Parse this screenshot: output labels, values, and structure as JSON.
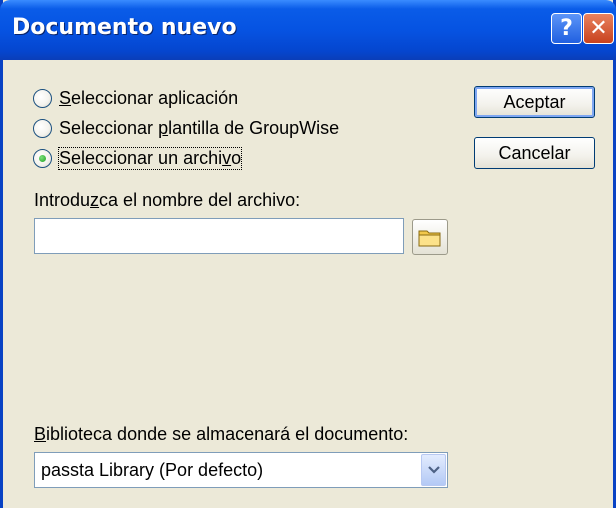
{
  "window": {
    "title": "Documento nuevo",
    "help_label": "?",
    "close_label": "✕"
  },
  "options": [
    {
      "pre": "",
      "accel": "S",
      "post": "eleccionar aplicación",
      "checked": false
    },
    {
      "pre": "Seleccionar ",
      "accel": "p",
      "post": "lantilla de GroupWise",
      "checked": false
    },
    {
      "pre": "Seleccionar un archi",
      "accel": "v",
      "post": "o",
      "checked": true
    }
  ],
  "buttons": {
    "ok_label": "Aceptar",
    "cancel_label": "Cancelar"
  },
  "file": {
    "label_pre": "Introdu",
    "label_accel": "z",
    "label_post": "ca el nombre del archivo:",
    "value": "",
    "browse_icon": "folder-icon"
  },
  "library": {
    "label_pre": "",
    "label_accel": "B",
    "label_post": "iblioteca donde se almacenará el documento:",
    "selected": "passta Library  (Por defecto)",
    "arrow_icon": "chevron-down-icon"
  },
  "colors": {
    "title_bar": "#0653E2",
    "dialog_bg": "#ECE9D8",
    "radio_checked": "#21A121",
    "close_button": "#C8421E"
  }
}
